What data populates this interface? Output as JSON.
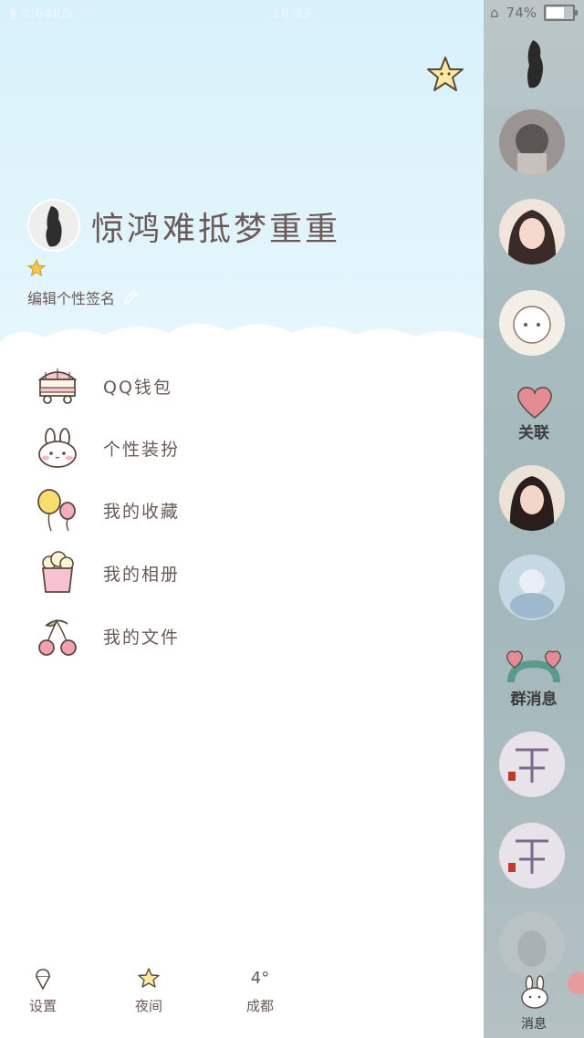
{
  "status_bar": {
    "network": "4.64K/s",
    "time": "18:43",
    "battery": "74%",
    "battery_level": 0.74
  },
  "profile": {
    "nickname": "惊鸿难抵梦重重",
    "signature_label": "编辑个性签名"
  },
  "menu": [
    {
      "label": "QQ钱包",
      "icon": "cart-icon"
    },
    {
      "label": "个性装扮",
      "icon": "bunny-icon"
    },
    {
      "label": "我的收藏",
      "icon": "balloons-icon"
    },
    {
      "label": "我的相册",
      "icon": "popcorn-icon"
    },
    {
      "label": "我的文件",
      "icon": "cherry-icon"
    }
  ],
  "bottom_bar": {
    "settings": "设置",
    "night": "夜间",
    "weather_temp": "4°",
    "weather_city": "成都"
  },
  "sidebar": {
    "contacts_label": "关联",
    "group_messages_label": "群消息",
    "messages_label": "消息"
  },
  "colors": {
    "header_bg": "#d8f1fb",
    "text": "#6a5a58",
    "sidebar_bg": "#a9bcc0",
    "heart": "#e38c94"
  }
}
